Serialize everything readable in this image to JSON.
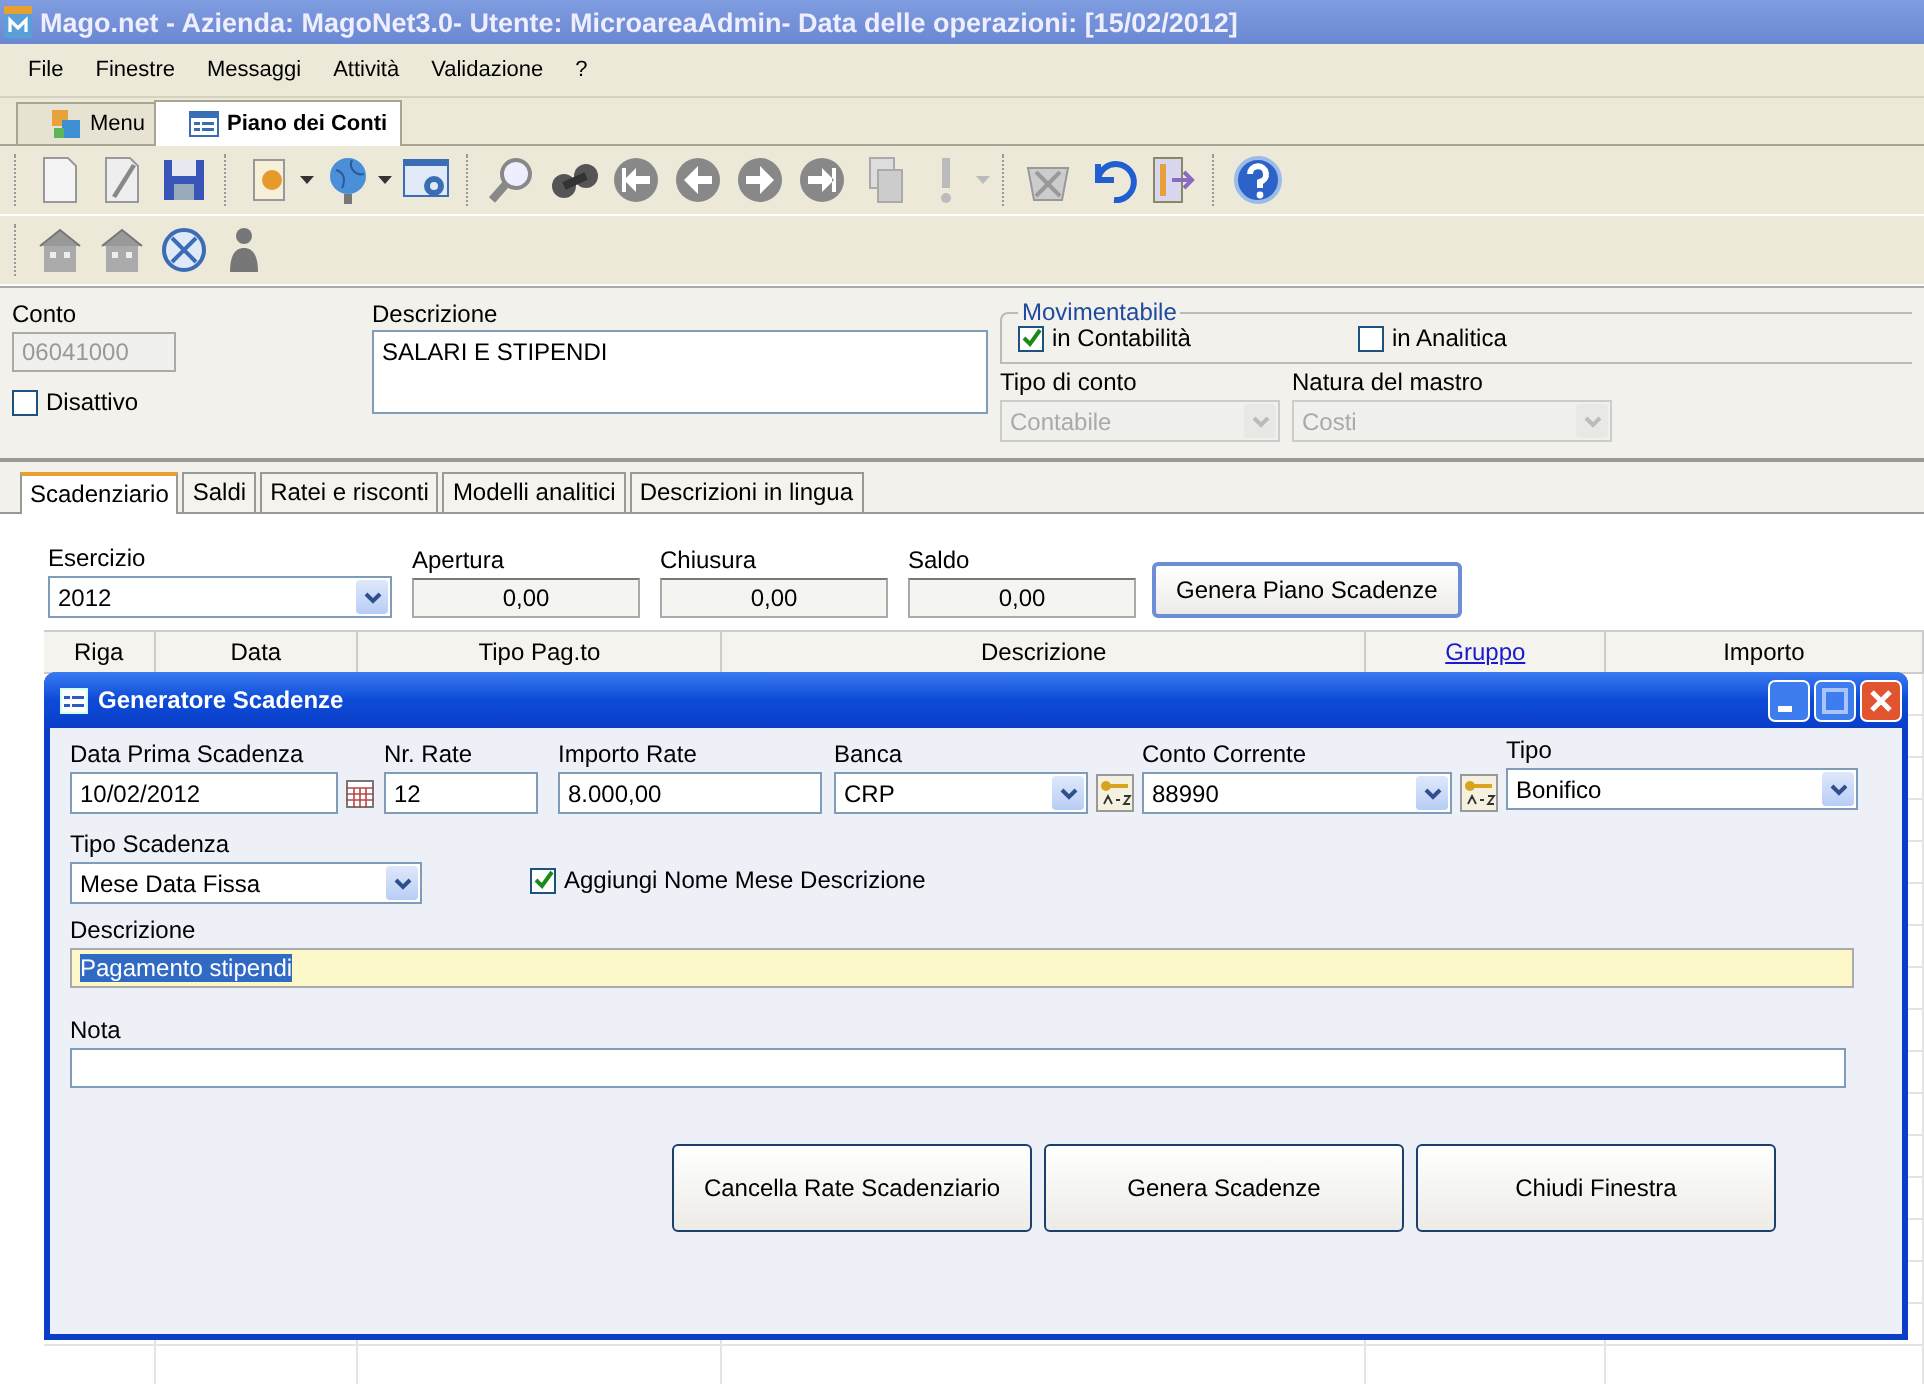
{
  "window": {
    "title": "Mago.net - Azienda: MagoNet3.0- Utente: MicroareaAdmin- Data delle operazioni: [15/02/2012]"
  },
  "menu": [
    "File",
    "Finestre",
    "Messaggi",
    "Attività",
    "Validazione",
    "?"
  ],
  "doc_tabs": [
    {
      "label": "Menu",
      "selected": false
    },
    {
      "label": "Piano dei Conti",
      "selected": true
    }
  ],
  "account": {
    "conto_label": "Conto",
    "conto": "06041000",
    "disattivo_label": "Disattivo",
    "disattivo": false,
    "descrizione_label": "Descrizione",
    "descrizione": "SALARI E STIPENDI",
    "movimentabile": {
      "title": "Movimentabile",
      "options": [
        {
          "label": "in Contabilità",
          "checked": true
        },
        {
          "label": "in Analitica",
          "checked": false
        }
      ]
    },
    "tipo_label": "Tipo di conto",
    "tipo": "Contabile",
    "natura_label": "Natura del mastro",
    "natura": "Costi"
  },
  "tabs": [
    {
      "label": "Scadenziario",
      "selected": true
    },
    {
      "label": "Saldi",
      "selected": false
    },
    {
      "label": "Ratei e risconti",
      "selected": false
    },
    {
      "label": "Modelli analitici",
      "selected": false
    },
    {
      "label": "Descrizioni in lingua",
      "selected": false
    }
  ],
  "scadenziario": {
    "esercizio_label": "Esercizio",
    "esercizio": "2012",
    "totals": [
      {
        "label": "Apertura",
        "value": "0,00"
      },
      {
        "label": "Chiusura",
        "value": "0,00"
      },
      {
        "label": "Saldo",
        "value": "0,00"
      }
    ],
    "button": "Genera Piano Scadenze",
    "columns": [
      {
        "label": "Riga",
        "link": false
      },
      {
        "label": "Data",
        "link": false
      },
      {
        "label": "Tipo Pag.to",
        "link": false
      },
      {
        "label": "Descrizione",
        "link": false
      },
      {
        "label": "Gruppo",
        "link": true
      },
      {
        "label": "Importo",
        "link": false
      }
    ]
  },
  "dialog": {
    "title": "Generatore Scadenze",
    "fields": [
      {
        "kind": "date",
        "label": "Data Prima Scadenza",
        "value": "10/02/2012"
      },
      {
        "kind": "text",
        "label": "Nr. Rate",
        "value": "12"
      },
      {
        "kind": "text",
        "label": "Importo Rate",
        "value": "8.000,00"
      },
      {
        "kind": "lookup",
        "label": "Banca",
        "value": "CRP"
      },
      {
        "kind": "lookup",
        "label": "Conto Corrente",
        "value": "88990"
      },
      {
        "kind": "combo",
        "label": "Tipo",
        "value": "Bonifico"
      }
    ],
    "tipo_scadenza_label": "Tipo Scadenza",
    "tipo_scadenza": "Mese Data Fissa",
    "aggiungi": {
      "label": "Aggiungi Nome Mese Descrizione",
      "checked": true
    },
    "descrizione_label": "Descrizione",
    "descrizione": "Pagamento stipendi",
    "nota_label": "Nota",
    "buttons": [
      "Cancella Rate Scadenziario",
      "Genera Scadenze",
      "Chiudi Finestra"
    ]
  }
}
